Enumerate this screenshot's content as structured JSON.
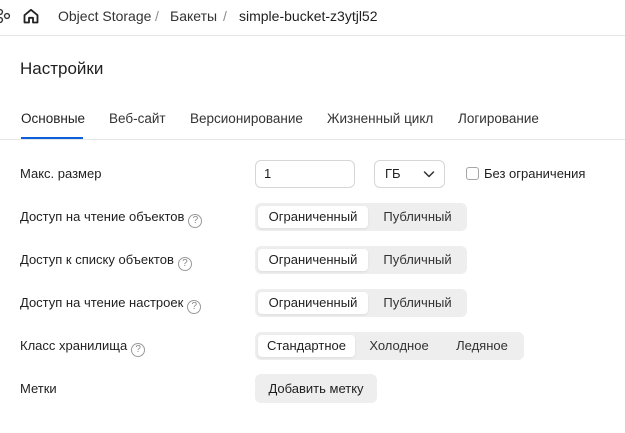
{
  "breadcrumb": {
    "items": [
      "Object Storage",
      "Бакеты",
      "simple-bucket-z3ytjl52"
    ],
    "separator": "/"
  },
  "page": {
    "title": "Настройки"
  },
  "tabs": [
    {
      "label": "Основные",
      "active": true
    },
    {
      "label": "Веб-сайт"
    },
    {
      "label": "Версионирование"
    },
    {
      "label": "Жизненный цикл"
    },
    {
      "label": "Логирование"
    }
  ],
  "form": {
    "max_size": {
      "label": "Макс. размер",
      "value": "1",
      "unit": "ГБ",
      "unlimited_label": "Без ограничения",
      "unlimited_checked": false
    },
    "read_objects": {
      "label": "Доступ на чтение объектов",
      "options": [
        "Ограниченный",
        "Публичный"
      ],
      "selected": "Ограниченный"
    },
    "list_objects": {
      "label": "Доступ к списку объектов",
      "options": [
        "Ограниченный",
        "Публичный"
      ],
      "selected": "Ограниченный"
    },
    "read_settings": {
      "label": "Доступ на чтение настроек",
      "options": [
        "Ограниченный",
        "Публичный"
      ],
      "selected": "Ограниченный"
    },
    "storage_class": {
      "label": "Класс хранилища",
      "options": [
        "Стандартное",
        "Холодное",
        "Ледяное"
      ],
      "selected": "Стандартное"
    },
    "labels": {
      "label": "Метки",
      "add_button": "Добавить метку"
    }
  },
  "help_glyph": "?",
  "colors": {
    "accent": "#0b5fd8",
    "segment_bg": "#eeeeee",
    "divider": "#e6e6e6"
  },
  "icons": {
    "nav": "nodes-icon",
    "home": "home-icon",
    "select": "chevron-down-icon",
    "help": "help-circle-icon"
  }
}
